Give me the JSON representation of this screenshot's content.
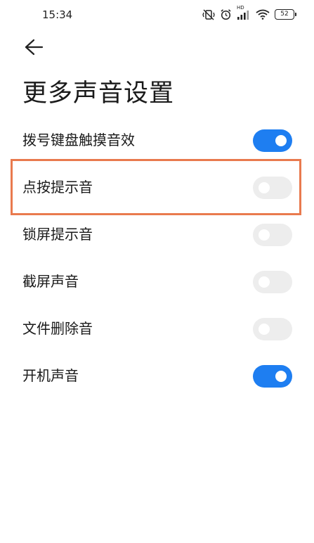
{
  "status_bar": {
    "time": "15:34",
    "network_label": "HD",
    "battery": "52"
  },
  "header": {
    "title": "更多声音设置"
  },
  "settings": [
    {
      "label": "拨号键盘触摸音效",
      "enabled": true
    },
    {
      "label": "点按提示音",
      "enabled": false
    },
    {
      "label": "锁屏提示音",
      "enabled": false
    },
    {
      "label": "截屏声音",
      "enabled": false
    },
    {
      "label": "文件删除音",
      "enabled": false
    },
    {
      "label": "开机声音",
      "enabled": true
    }
  ],
  "colors": {
    "toggle_on": "#1e7ef1",
    "toggle_off": "#ededed",
    "highlight_border": "#e97a4e"
  }
}
